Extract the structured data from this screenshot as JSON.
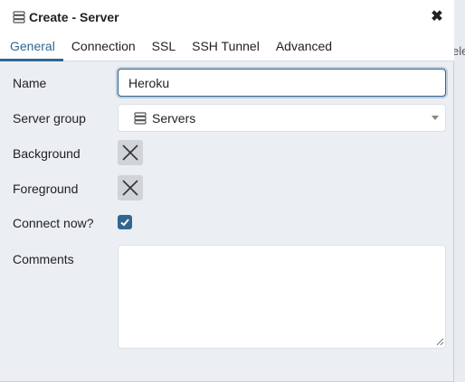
{
  "backdrop": {
    "text": "ele"
  },
  "dialog": {
    "title": "Create - Server",
    "close_symbol": "✖",
    "icon": "server-icon"
  },
  "tabs": [
    {
      "label": "General",
      "active": true
    },
    {
      "label": "Connection",
      "active": false
    },
    {
      "label": "SSL",
      "active": false
    },
    {
      "label": "SSH Tunnel",
      "active": false
    },
    {
      "label": "Advanced",
      "active": false
    }
  ],
  "form": {
    "name": {
      "label": "Name",
      "value": "Heroku"
    },
    "server_group": {
      "label": "Server group",
      "value": "Servers",
      "icon": "server-group-icon"
    },
    "background": {
      "label": "Background",
      "icon": "x-icon"
    },
    "foreground": {
      "label": "Foreground",
      "icon": "x-icon"
    },
    "connect_now": {
      "label": "Connect now?",
      "checked": true
    },
    "comments": {
      "label": "Comments",
      "value": ""
    }
  },
  "colors": {
    "accent": "#326690",
    "swatch": "#d0d3d8",
    "panel": "#ebeef3"
  }
}
